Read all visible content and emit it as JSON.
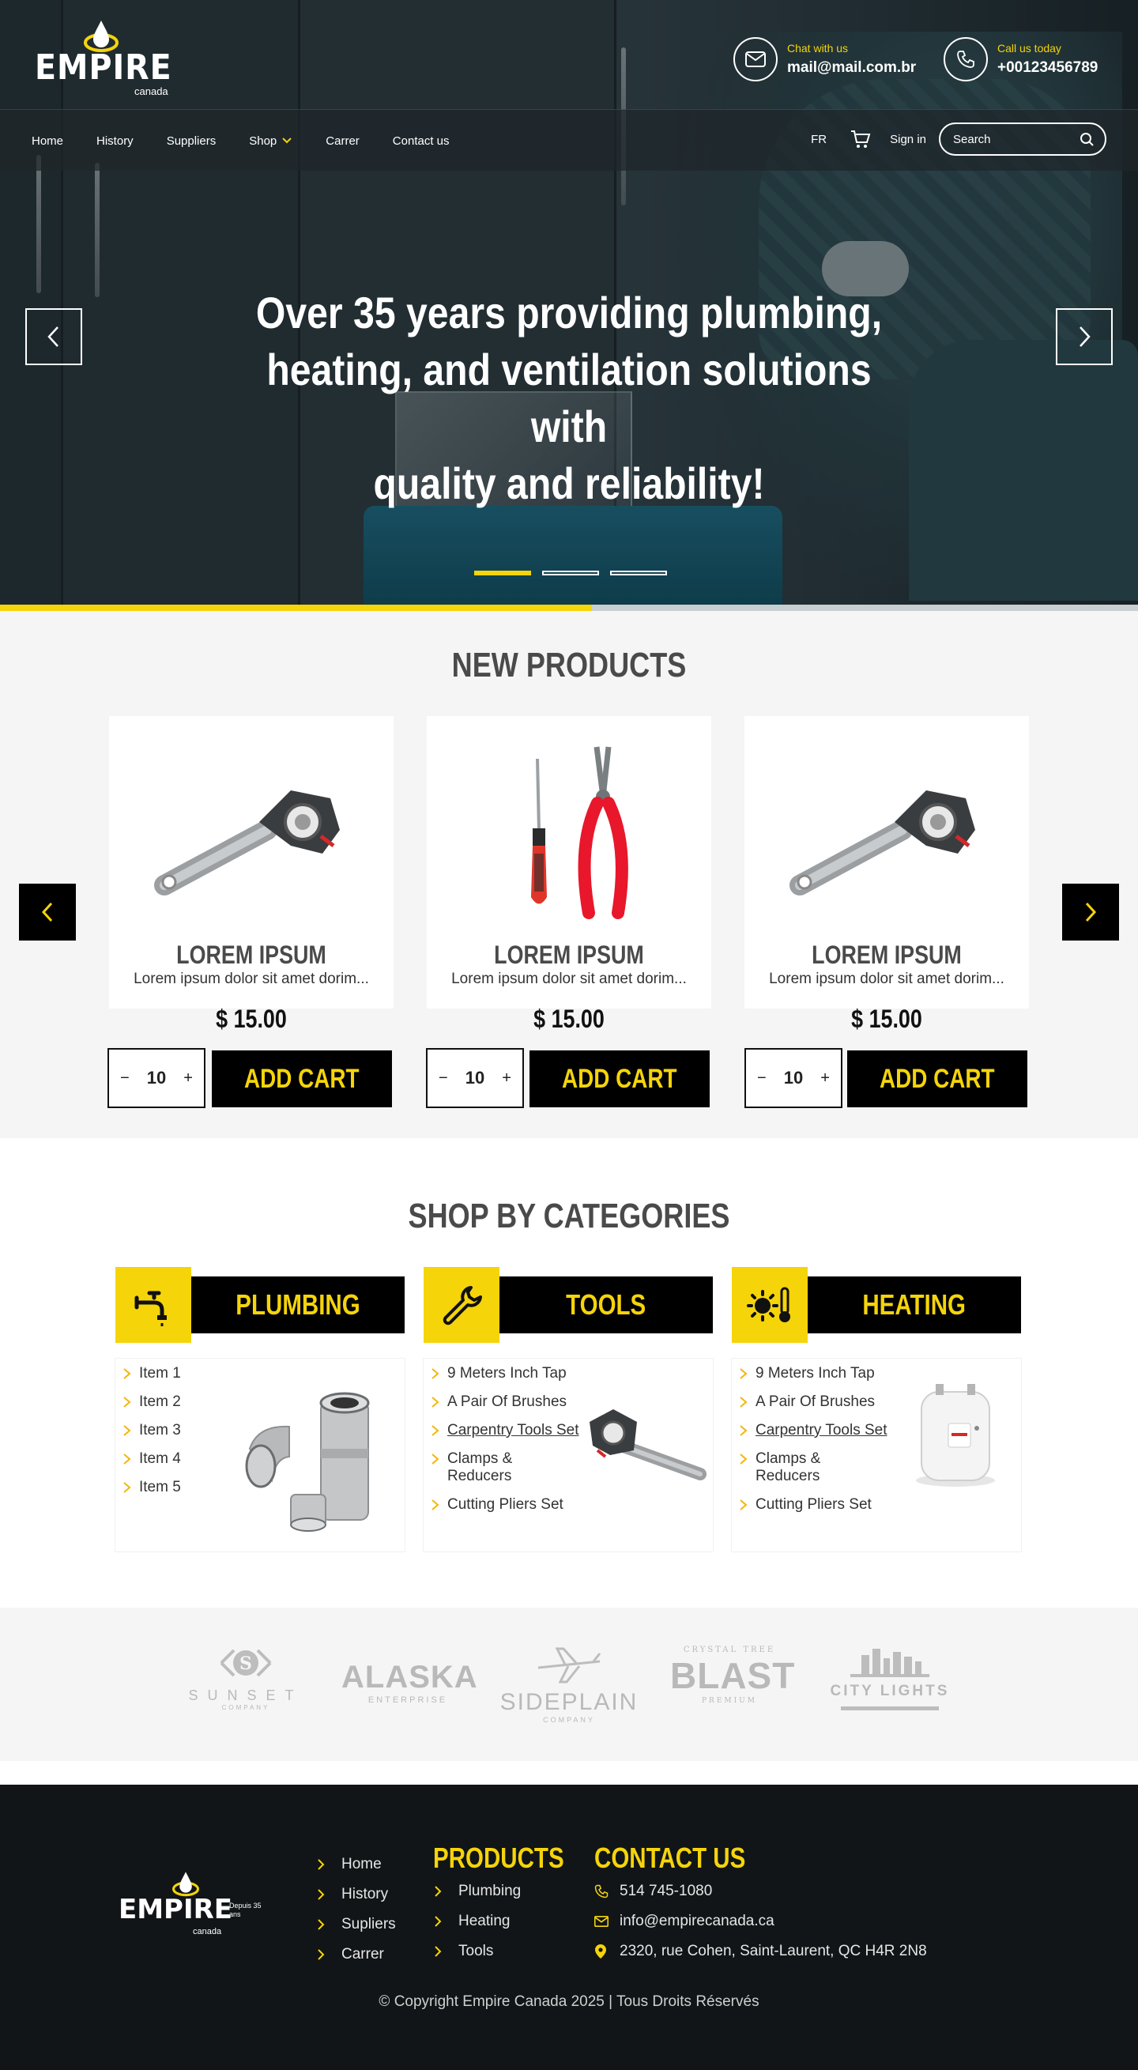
{
  "header": {
    "logo_text": "EMPIRE",
    "logo_sub": "canada",
    "chat": {
      "label": "Chat with us",
      "value": "mail@mail.com.br"
    },
    "call": {
      "label": "Call us today",
      "value": "+00123456789"
    }
  },
  "nav": {
    "items": [
      "Home",
      "History",
      "Suppliers",
      "Shop",
      "Carrer",
      "Contact us"
    ],
    "lang": "FR",
    "signin": "Sign in",
    "search_placeholder": "Search"
  },
  "hero": {
    "lines": [
      "Over 35 years providing plumbing,",
      "heating, and ventilation solutions with",
      "quality and reliability!"
    ],
    "slide_count": 3,
    "active_slide": 1,
    "progress": 0.52
  },
  "new_products": {
    "title": "NEW PRODUCTS",
    "items": [
      {
        "name": "LOREM IPSUM",
        "desc": "Lorem ipsum dolor sit amet dorim...",
        "price": "$ 15.00",
        "qty": "10",
        "cta": "ADD CART",
        "image": "pipe-cutter"
      },
      {
        "name": "LOREM IPSUM",
        "desc": "Lorem ipsum dolor sit amet dorim...",
        "price": "$ 15.00",
        "qty": "10",
        "cta": "ADD CART",
        "image": "pliers-screwdriver"
      },
      {
        "name": "LOREM IPSUM",
        "desc": "Lorem ipsum dolor sit amet dorim...",
        "price": "$ 15.00",
        "qty": "10",
        "cta": "ADD CART",
        "image": "pipe-cutter"
      }
    ]
  },
  "categories": {
    "title": "SHOP BY CATEGORIES",
    "items": [
      {
        "name": "PLUMBING",
        "icon": "faucet-icon",
        "list": [
          "Item 1",
          "Item 2",
          "Item 3",
          "Item 4",
          "Item 5"
        ]
      },
      {
        "name": "TOOLS",
        "icon": "wrench-icon",
        "list": [
          "9 Meters Inch Tap",
          "A Pair Of Brushes",
          "Carpentry Tools Set",
          "Clamps & Reducers",
          "Cutting Pliers Set"
        ]
      },
      {
        "name": "HEATING",
        "icon": "sun-thermometer-icon",
        "list": [
          "9 Meters Inch Tap",
          "A Pair Of Brushes",
          "Carpentry Tools Set",
          "Clamps & Reducers",
          "Cutting Pliers Set"
        ]
      }
    ]
  },
  "brands": [
    {
      "name": "SUNSET",
      "sub": "COMPANY",
      "top": ""
    },
    {
      "name": "ALASKA",
      "sub": "ENTERPRISE",
      "top": ""
    },
    {
      "name": "SIDEPLAIN",
      "sub": "COMPANY",
      "top": ""
    },
    {
      "name": "BLAST",
      "sub": "PREMIUM",
      "top": "CRYSTAL TREE"
    },
    {
      "name": "CITY LIGHTS",
      "sub": "",
      "top": ""
    }
  ],
  "footer": {
    "logo_text": "EMPIRE",
    "logo_badge": "Depuis 35 ans",
    "logo_sub": "canada",
    "links": [
      "Home",
      "History",
      "Supliers",
      "Carrer"
    ],
    "products_title": "PRODUCTS",
    "products": [
      "Plumbing",
      "Heating",
      "Tools"
    ],
    "contact_title": "CONTACT US",
    "phone": "514 745-1080",
    "email": "info@empirecanada.ca",
    "address": "2320, rue Cohen, Saint-Laurent, QC H4R 2N8",
    "copyright": "© Copyright Empire Canada 2025 | Tous Droits Réservés"
  },
  "colors": {
    "accent": "#f5d40a",
    "dark": "#000000",
    "footer_bg": "#111517"
  }
}
